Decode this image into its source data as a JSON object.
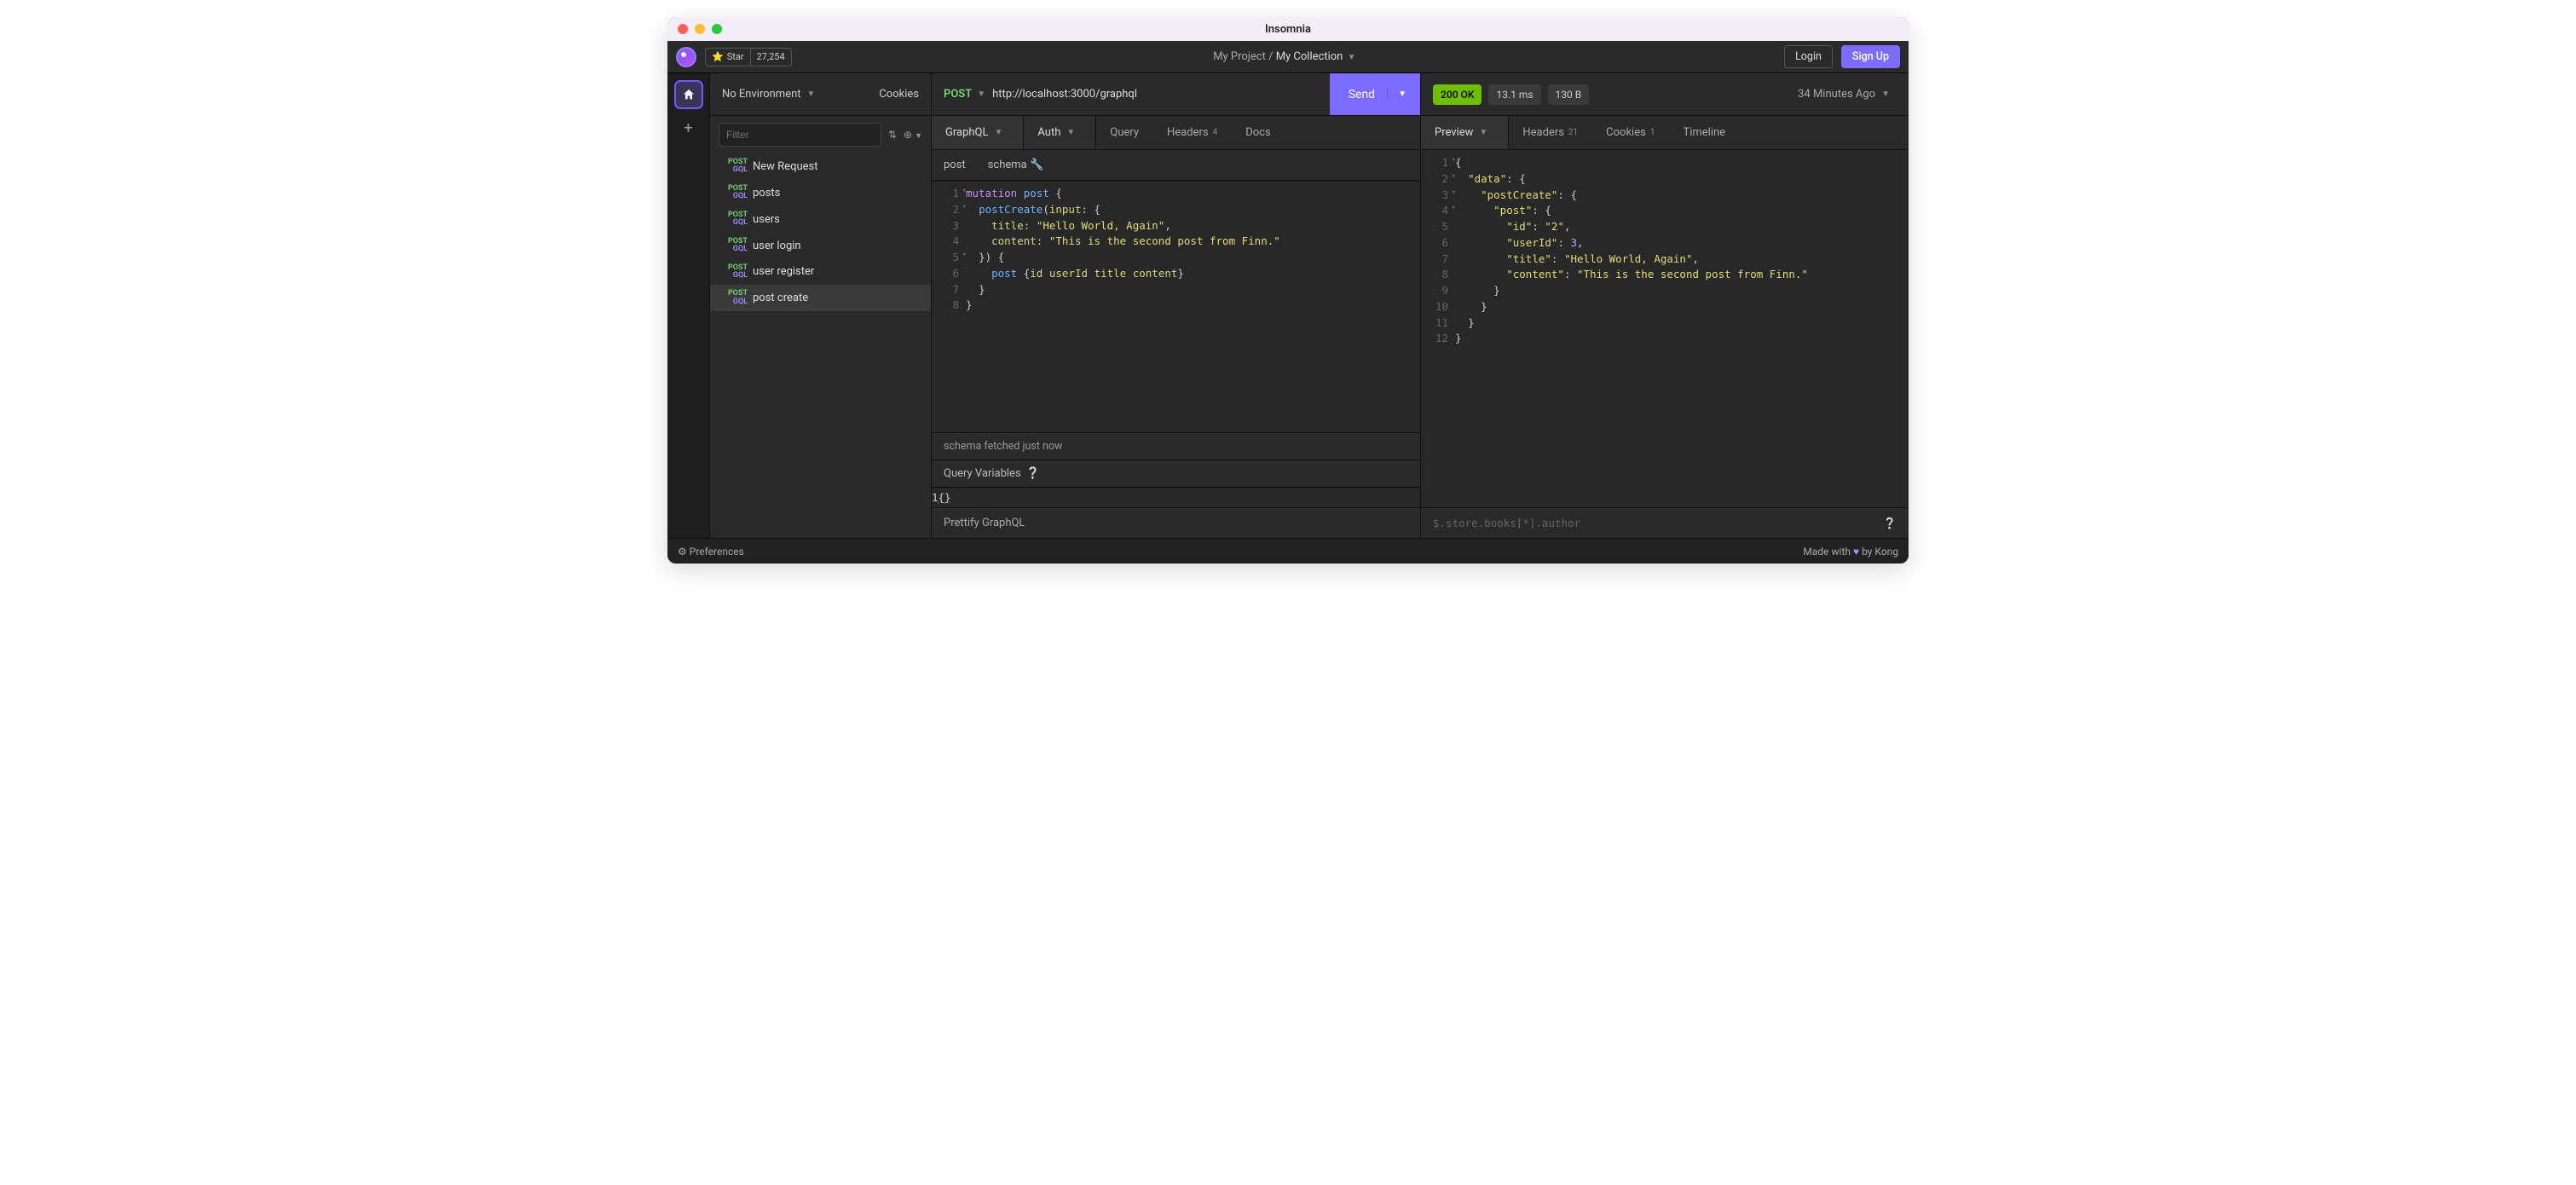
{
  "window": {
    "title": "Insomnia"
  },
  "topbar": {
    "star_label": "Star",
    "star_count": "27,254",
    "breadcrumb_project": "My Project",
    "breadcrumb_collection": "My Collection",
    "login": "Login",
    "signup": "Sign Up"
  },
  "sidebar": {
    "environment": "No Environment",
    "cookies": "Cookies",
    "filter_placeholder": "Filter",
    "requests": [
      {
        "method": "POST",
        "type": "GQL",
        "name": "New Request"
      },
      {
        "method": "POST",
        "type": "GQL",
        "name": "posts"
      },
      {
        "method": "POST",
        "type": "GQL",
        "name": "users"
      },
      {
        "method": "POST",
        "type": "GQL",
        "name": "user login"
      },
      {
        "method": "POST",
        "type": "GQL",
        "name": "user register"
      },
      {
        "method": "POST",
        "type": "GQL",
        "name": "post create"
      }
    ]
  },
  "request": {
    "method": "POST",
    "url": "http://localhost:3000/graphql",
    "send": "Send",
    "tabs": {
      "graphql": "GraphQL",
      "auth": "Auth",
      "query": "Query",
      "headers": "Headers",
      "headers_badge": "4",
      "docs": "Docs"
    },
    "subtabs": {
      "post": "post",
      "schema": "schema"
    },
    "editor_lines": [
      "mutation post {",
      "  postCreate(input: {",
      "    title: \"Hello World, Again\",",
      "    content: \"This is the second post from Finn.\"",
      "  }) {",
      "    post {id userId title content}",
      "  }",
      "}"
    ],
    "schema_status": "schema fetched just now",
    "qvar_label": "Query Variables",
    "qvar_body": "{}",
    "prettify": "Prettify GraphQL"
  },
  "response": {
    "status_code": "200",
    "status_text": "OK",
    "time": "13.1 ms",
    "size": "130 B",
    "ago": "34 Minutes Ago",
    "tabs": {
      "preview": "Preview",
      "headers": "Headers",
      "headers_badge": "21",
      "cookies": "Cookies",
      "cookies_badge": "1",
      "timeline": "Timeline"
    },
    "body_lines": [
      "{",
      "  \"data\": {",
      "    \"postCreate\": {",
      "      \"post\": {",
      "        \"id\": \"2\",",
      "        \"userId\": 3,",
      "        \"title\": \"Hello World, Again\",",
      "        \"content\": \"This is the second post from Finn.\"",
      "      }",
      "    }",
      "  }",
      "}"
    ],
    "jsonpath_placeholder": "$.store.books[*].author"
  },
  "footer": {
    "prefs": "Preferences",
    "made": "Made with",
    "by": "by Kong"
  }
}
